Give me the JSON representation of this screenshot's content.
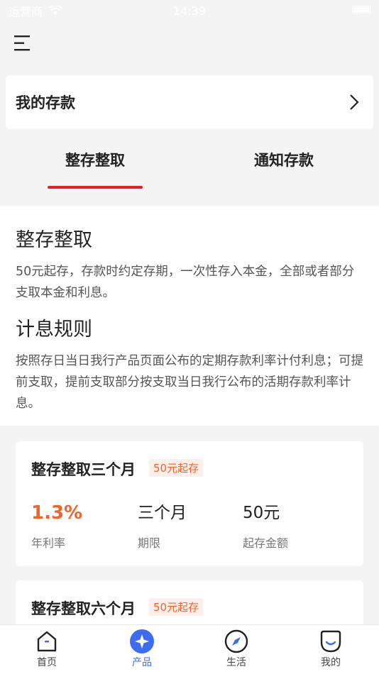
{
  "status_bar": {
    "carrier": "运营商",
    "time": "14:39"
  },
  "header": {
    "menu_icon": "menu-icon"
  },
  "my_deposit": {
    "title": "我的存款"
  },
  "tabs": [
    {
      "label": "整存整取",
      "active": true
    },
    {
      "label": "通知存款",
      "active": false
    }
  ],
  "intro": {
    "heading1": "整存整取",
    "text1": "50元起存，存款时约定存期，一次性存入本金，全部或者部分支取本金和利息。",
    "heading2": "计息规则",
    "text2": "按照存日当日我行产品页面公布的定期存款利率计付利息；可提前支取，提前支取部分按支取当日我行公布的活期存款利率计息。"
  },
  "products": [
    {
      "name": "整存整取三个月",
      "badge": "50元起存",
      "rate": "1.3%",
      "rate_label": "年利率",
      "term": "三个月",
      "term_label": "期限",
      "min_amount": "50元",
      "min_amount_label": "起存金额"
    },
    {
      "name": "整存整取六个月",
      "badge": "50元起存"
    }
  ],
  "tabbar": {
    "items": [
      {
        "label": "首页",
        "icon": "home-icon"
      },
      {
        "label": "产品",
        "icon": "sparkle-icon",
        "active": true
      },
      {
        "label": "生活",
        "icon": "compass-icon"
      },
      {
        "label": "我的",
        "icon": "profile-icon"
      }
    ]
  },
  "colors": {
    "accent_red": "#e6202a",
    "rate_orange": "#f0632d",
    "active_blue": "#3d6cf0"
  }
}
